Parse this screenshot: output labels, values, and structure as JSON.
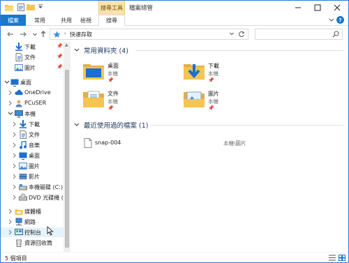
{
  "window": {
    "title": "檔案總管",
    "contextual_tab_group": "搜尋工具"
  },
  "ribbon": {
    "tabs": [
      {
        "label": "檔案"
      },
      {
        "label": "常用"
      },
      {
        "label": "共用"
      },
      {
        "label": "檢視"
      },
      {
        "label": "搜尋"
      }
    ],
    "help_label": "?"
  },
  "address_bar": {
    "path": "快速存取",
    "search_placeholder": ""
  },
  "sidebar": {
    "items": [
      {
        "label": "下載",
        "icon": "download-icon",
        "pinned": true
      },
      {
        "label": "文件",
        "icon": "document-icon",
        "pinned": true
      },
      {
        "label": "圖片",
        "icon": "picture-icon",
        "pinned": true
      },
      {
        "label": "桌面",
        "icon": "desktop-icon"
      },
      {
        "label": "OneDrive",
        "icon": "cloud-icon"
      },
      {
        "label": "PCuSER",
        "icon": "user-icon"
      },
      {
        "label": "本機",
        "icon": "computer-icon"
      },
      {
        "label": "下載",
        "icon": "download-icon"
      },
      {
        "label": "文件",
        "icon": "document-icon"
      },
      {
        "label": "音樂",
        "icon": "music-icon"
      },
      {
        "label": "桌面",
        "icon": "desktop-icon"
      },
      {
        "label": "圖片",
        "icon": "picture-icon"
      },
      {
        "label": "影片",
        "icon": "video-icon"
      },
      {
        "label": "本機磁碟 (C:)",
        "icon": "drive-icon"
      },
      {
        "label": "DVD 光碟機 (D",
        "icon": "dvd-icon"
      },
      {
        "label": "媒體櫃",
        "icon": "library-icon"
      },
      {
        "label": "網路",
        "icon": "network-icon"
      },
      {
        "label": "控制台",
        "icon": "control-panel-icon"
      },
      {
        "label": "資源回收筒",
        "icon": "recycle-bin-icon"
      }
    ],
    "pin_glyph": "📌"
  },
  "content": {
    "frequent": {
      "title": "常用資料夾 (4)",
      "tiles": [
        {
          "name": "桌面",
          "location": "本機",
          "pin": "📌"
        },
        {
          "name": "下載",
          "location": "本機",
          "pin": "📌"
        },
        {
          "name": "文件",
          "location": "本機",
          "pin": "📌"
        },
        {
          "name": "圖片",
          "location": "本機",
          "pin": "📌"
        }
      ]
    },
    "recent": {
      "title": "最近使用過的檔案 (1)",
      "files": [
        {
          "name": "snap-004",
          "location": "本機\\圖片"
        }
      ]
    }
  },
  "status_bar": {
    "item_count": "5 個項目"
  },
  "colors": {
    "accent": "#1979ca",
    "contextual_tab": "#f9e2b0",
    "folder": "#f5c453",
    "group_title": "#1e395b"
  }
}
